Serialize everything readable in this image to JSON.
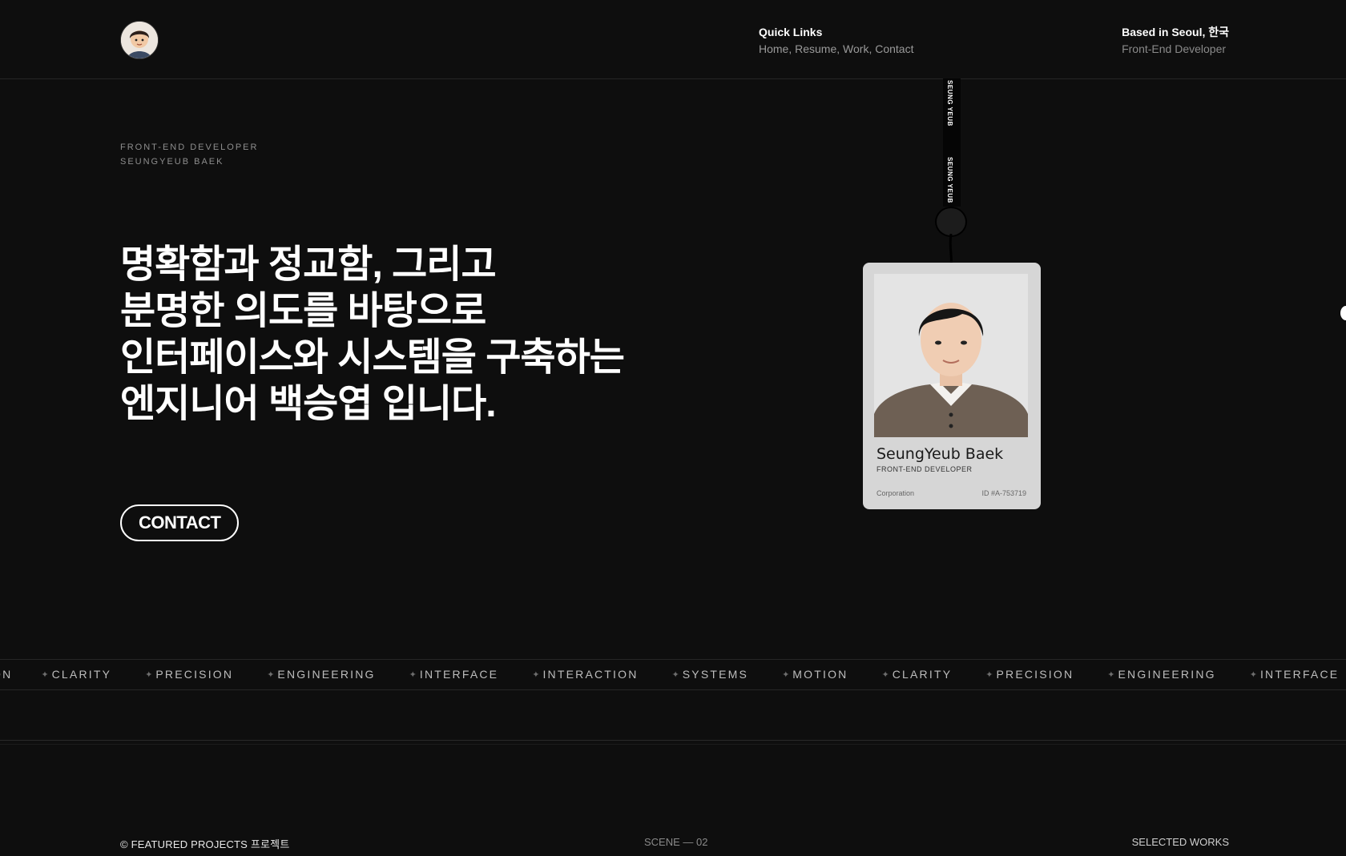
{
  "header": {
    "avatar_alt": "profile avatar",
    "quick_links": {
      "title": "Quick Links",
      "links": "Home, Resume, Work, Contact"
    },
    "location": {
      "title": "Based in Seoul, 한국",
      "subtitle": "Front-End Developer"
    }
  },
  "hero": {
    "role_line1": "FRONT-END DEVELOPER",
    "role_line2": "SEUNGYEUB BAEK",
    "headline": [
      "명확함과 정교함, 그리고",
      "분명한 의도를 바탕으로",
      "인터페이스와 시스템을 구축하는",
      "엔지니어 백승엽 입니다."
    ],
    "contact_label": "CONTACT"
  },
  "badge": {
    "lanyard_text": "SEUNG YEUB",
    "name": "SeungYeub Baek",
    "title": "FRONT-END DEVELOPER",
    "corporation": "Corporation",
    "id": "ID #A-753719"
  },
  "marquee": {
    "items": [
      "ON",
      "CLARITY",
      "PRECISION",
      "ENGINEERING",
      "INTERFACE",
      "INTERACTION",
      "SYSTEMS",
      "MOTION",
      "CLARITY",
      "PRECISION",
      "ENGINEERING",
      "INTERFACE"
    ]
  },
  "footer": {
    "left": "© FEATURED PROJECTS 프로젝트",
    "middle": "SCENE — 02",
    "right": "SELECTED WORKS"
  }
}
